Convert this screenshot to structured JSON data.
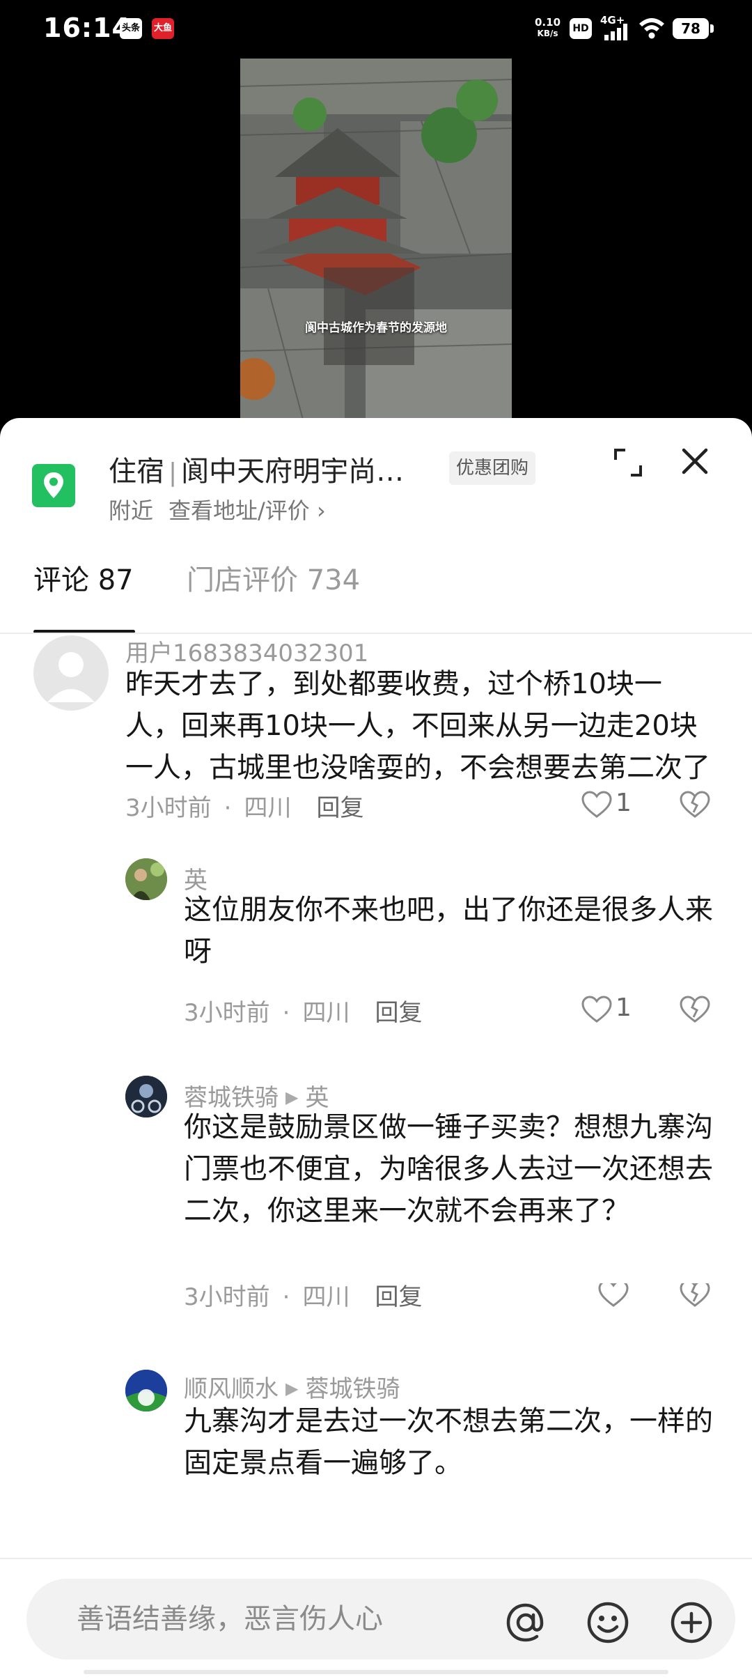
{
  "status_bar": {
    "time": "16:14",
    "app_icon_1": "头条",
    "app_icon_2": "大鱼",
    "net_speed": "0.10",
    "net_unit": "KB/s",
    "hd": "HD",
    "signal": "4G+",
    "battery": "78"
  },
  "video": {
    "caption": "阆中古城作为春节的发源地"
  },
  "poi": {
    "category": "住宿",
    "name": "阆中天府明宇尚…",
    "badge": "优惠团购",
    "nearby": "附近",
    "link": "查看地址/评价 ›"
  },
  "tabs": [
    {
      "label": "评论 87"
    },
    {
      "label": "门店评价 734"
    }
  ],
  "comments": [
    {
      "user": "用户1683834032301",
      "text": "昨天才去了，到处都要收费，过个桥10块一人，回来再10块一人，不回来从另一边走20块一人，古城里也没啥耍的，不会想要去第二次了",
      "time": "3小时前",
      "location": "四川",
      "reply": "回复",
      "likes": "1"
    },
    {
      "user": "英",
      "text": "这位朋友你不来也吧，出了你还是很多人来呀",
      "time": "3小时前",
      "location": "四川",
      "reply": "回复",
      "likes": "1"
    },
    {
      "user": "蓉城铁骑",
      "reply_to": "英",
      "text": "你这是鼓励景区做一锤子买卖？想想九寨沟门票也不便宜，为啥很多人去过一次还想去二次，你这里来一次就不会再来了？",
      "time": "3小时前",
      "location": "四川",
      "reply": "回复"
    },
    {
      "user": "顺风顺水",
      "reply_to": "蓉城铁骑",
      "text": "九寨沟才是去过一次不想去第二次，一样的固定景点看一遍够了。"
    }
  ],
  "input": {
    "placeholder": "善语结善缘，恶言伤人心"
  },
  "icons": {
    "location": "map-pin-icon",
    "expand": "expand-icon",
    "close": "close-icon",
    "like": "heart-icon",
    "dislike": "broken-heart-icon",
    "mention": "at-icon",
    "emoji": "smiley-icon",
    "add": "plus-icon"
  },
  "colors": {
    "poi_icon": "#23c061",
    "text_primary": "#161616",
    "text_secondary": "#9a9a9a"
  }
}
